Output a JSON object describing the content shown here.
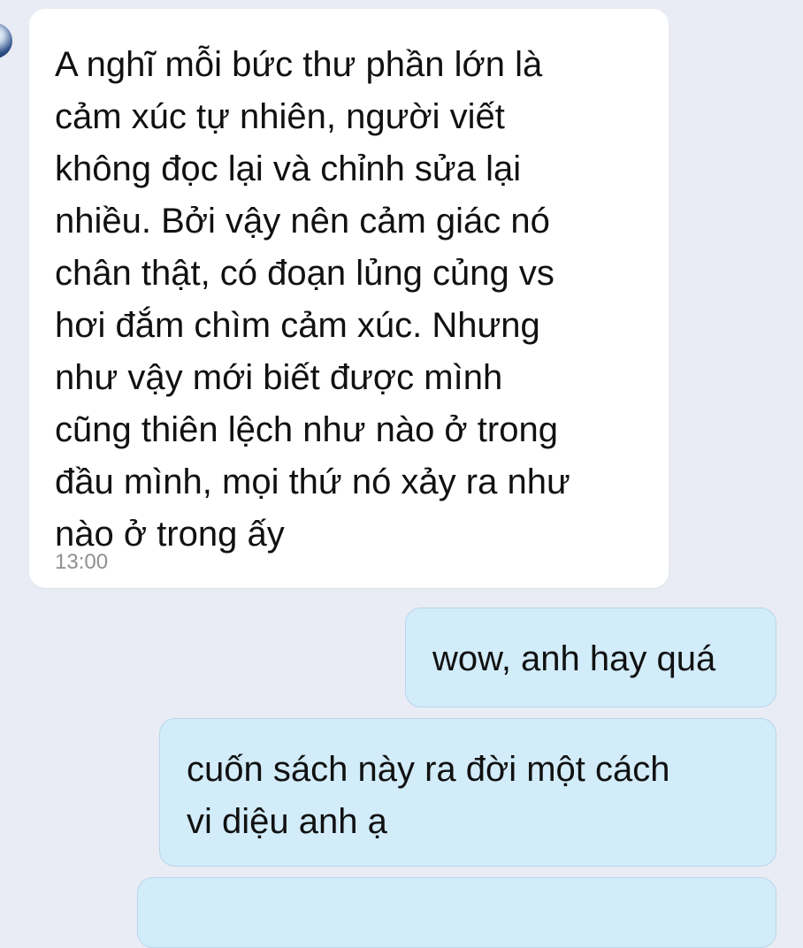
{
  "messages": {
    "incoming": {
      "text": "A nghĩ mỗi bức thư phần lớn là\ncảm xúc tự nhiên, người viết\nkhông đọc lại và chỉnh sửa lại\nnhiều. Bởi vậy nên cảm giác nó\nchân thật, có đoạn lủng củng vs\nhơi đắm chìm cảm xúc. Nhưng\nnhư vậy mới biết được mình\ncũng thiên lệch như nào ở trong\nđầu mình, mọi thứ nó xảy ra như\nnào ở trong ấy",
      "time": "13:00"
    },
    "outgoing": [
      {
        "text": "wow, anh hay quá"
      },
      {
        "text": "cuốn sách này ra đời một cách\nvi diệu anh ạ"
      }
    ]
  },
  "colors": {
    "background": "#e9ecf4",
    "incoming_bubble": "#ffffff",
    "outgoing_bubble": "#d2ecfa",
    "timestamp": "#8f8f94"
  }
}
